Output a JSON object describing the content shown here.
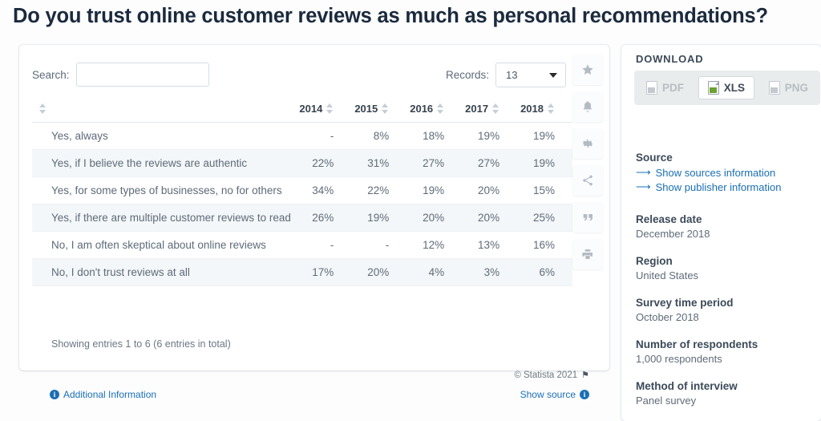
{
  "page_title": "Do you trust online customer reviews as much as personal recommendations?",
  "table_controls": {
    "search_label": "Search:",
    "search_value": "",
    "search_placeholder": "",
    "records_label": "Records:",
    "records_value": "13"
  },
  "table": {
    "columns": [
      "",
      "2014",
      "2015",
      "2016",
      "2017",
      "2018"
    ],
    "rows": [
      {
        "label": "Yes, always",
        "values": [
          "-",
          "8%",
          "18%",
          "19%",
          "19%"
        ]
      },
      {
        "label": "Yes, if I believe the reviews are authentic",
        "values": [
          "22%",
          "31%",
          "27%",
          "27%",
          "19%"
        ]
      },
      {
        "label": "Yes, for some types of businesses, no for others",
        "values": [
          "34%",
          "22%",
          "19%",
          "20%",
          "15%"
        ]
      },
      {
        "label": "Yes, if there are multiple customer reviews to read",
        "values": [
          "26%",
          "19%",
          "20%",
          "20%",
          "25%"
        ]
      },
      {
        "label": "No, I am often skeptical about online reviews",
        "values": [
          "-",
          "-",
          "12%",
          "13%",
          "16%"
        ]
      },
      {
        "label": "No, I don't trust reviews at all",
        "values": [
          "17%",
          "20%",
          "4%",
          "3%",
          "6%"
        ]
      }
    ],
    "footer": "Showing entries 1 to 6 (6 entries in total)"
  },
  "card_footer": {
    "additional_information": "Additional Information",
    "copyright": "© Statista 2021",
    "show_source": "Show source"
  },
  "tool_rail": [
    {
      "name": "favorite-icon",
      "label": "Favorite"
    },
    {
      "name": "notification-bell-icon",
      "label": "Notifications"
    },
    {
      "name": "gear-icon",
      "label": "Settings"
    },
    {
      "name": "share-icon",
      "label": "Share"
    },
    {
      "name": "quote-icon",
      "label": "Cite"
    },
    {
      "name": "print-icon",
      "label": "Print"
    }
  ],
  "download": {
    "title": "DOWNLOAD",
    "options": [
      {
        "label": "PDF",
        "enabled": false
      },
      {
        "label": "XLS",
        "enabled": true
      },
      {
        "label": "PNG",
        "enabled": false
      }
    ]
  },
  "source": {
    "heading": "Source",
    "links": [
      "Show sources information",
      "Show publisher information"
    ]
  },
  "meta": [
    {
      "heading": "Release date",
      "value": "December 2018"
    },
    {
      "heading": "Region",
      "value": "United States"
    },
    {
      "heading": "Survey time period",
      "value": "October 2018"
    },
    {
      "heading": "Number of respondents",
      "value": "1,000 respondents"
    },
    {
      "heading": "Method of interview",
      "value": "Panel survey"
    }
  ],
  "colors": {
    "title": "#1b2a3d",
    "link": "#1a6fb4",
    "stripe": "#f4f7f9",
    "xls_green": "#6aa32e"
  }
}
